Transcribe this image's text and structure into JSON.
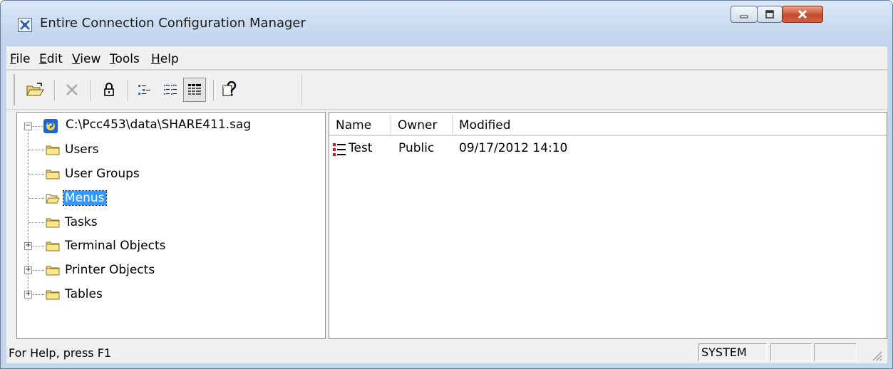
{
  "window": {
    "title": "Entire Connection Configuration Manager",
    "icon": "app-icon",
    "controls": [
      "minimize-icon",
      "maximize-icon",
      "close-icon"
    ]
  },
  "menu": {
    "items": [
      {
        "label": "File",
        "mnemonic": "F"
      },
      {
        "label": "Edit",
        "mnemonic": "E"
      },
      {
        "label": "View",
        "mnemonic": "V"
      },
      {
        "label": "Tools",
        "mnemonic": "T"
      },
      {
        "label": "Help",
        "mnemonic": "H"
      }
    ]
  },
  "toolbar": {
    "buttons": [
      "open-folder-icon",
      "delete-icon",
      "lock-icon",
      "large-icons-view-icon",
      "list-view-icon",
      "details-view-icon",
      "context-help-icon"
    ],
    "pressed": "details-view-icon"
  },
  "tree": {
    "root": "C:\\Pcc453\\data\\SHARE411.sag",
    "items": [
      {
        "label": "Users",
        "expandable": false
      },
      {
        "label": "User Groups",
        "expandable": false
      },
      {
        "label": "Menus",
        "expandable": false,
        "selected": true
      },
      {
        "label": "Tasks",
        "expandable": false
      },
      {
        "label": "Terminal Objects",
        "expandable": true
      },
      {
        "label": "Printer Objects",
        "expandable": true
      },
      {
        "label": "Tables",
        "expandable": true
      }
    ]
  },
  "list": {
    "columns": [
      "Name",
      "Owner",
      "Modified"
    ],
    "rows": [
      {
        "name": "Test",
        "owner": "Public",
        "modified": "09/17/2012 14:10",
        "icon": "menu-object-icon"
      }
    ]
  },
  "status": {
    "text": "For Help, press F1",
    "user": "SYSTEM"
  },
  "colors": {
    "selection": "#3399ff",
    "frame": "#c4d6ec",
    "close_button": "#c54a2b"
  }
}
